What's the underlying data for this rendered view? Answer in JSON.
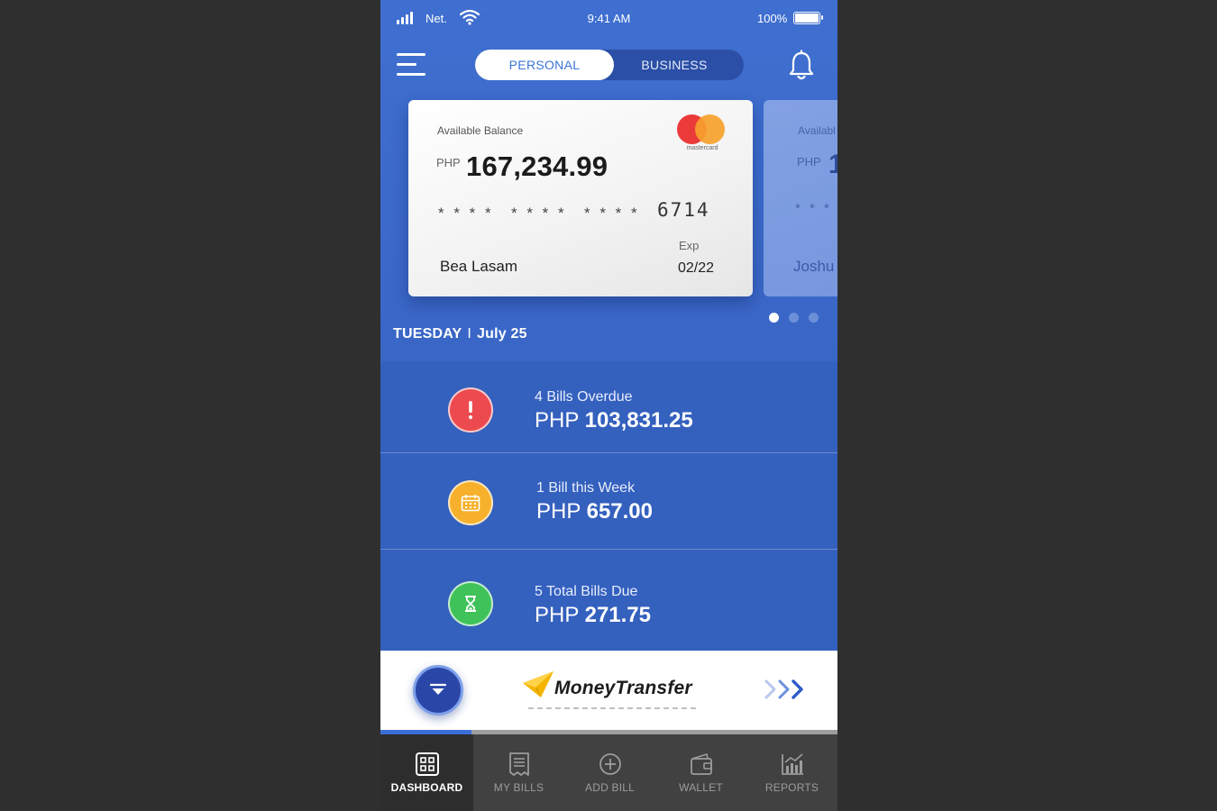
{
  "status_bar": {
    "carrier": "Net.",
    "time": "9:41 AM",
    "battery": "100%"
  },
  "header": {
    "tabs": [
      {
        "label": "PERSONAL",
        "active": true
      },
      {
        "label": "BUSINESS",
        "active": false
      }
    ],
    "menu_icon": "hamburger-menu-icon",
    "notification_icon": "bell-icon"
  },
  "cards": [
    {
      "label": "Available Balance",
      "currency": "PHP",
      "balance": "167,234.99",
      "masked_groups": [
        "* * * *",
        "* * * *",
        "* * * *"
      ],
      "last4": "6714",
      "exp_label": "Exp",
      "exp": "02/22",
      "holder": "Bea Lasam",
      "brand": "mastercard"
    },
    {
      "label": "Availabl",
      "currency": "PHP",
      "balance": "1",
      "masked": "* * * *",
      "holder": "Joshu"
    }
  ],
  "pagination": {
    "count": 3,
    "active_index": 0
  },
  "date": {
    "day": "TUESDAY",
    "separator": "I",
    "date": "July 25"
  },
  "summary": [
    {
      "label": "4 Bills Overdue",
      "currency": "PHP",
      "amount": "103,831.25",
      "icon": "exclamation-icon",
      "color": "#ec4a4f"
    },
    {
      "label": "1 Bill this Week",
      "currency": "PHP",
      "amount": "657.00",
      "icon": "calendar-icon",
      "color": "#f6b02b"
    },
    {
      "label": "5 Total Bills Due",
      "currency": "PHP",
      "amount": "271.75",
      "icon": "hourglass-icon",
      "color": "#3fc25a"
    }
  ],
  "transfer": {
    "brand": "MoneyTransfer",
    "icon": "paper-plane-icon",
    "action_icon": "triple-chevron-right-icon"
  },
  "progress": {
    "fraction": 0.2
  },
  "nav": [
    {
      "label": "DASHBOARD",
      "icon": "dashboard-icon",
      "active": true
    },
    {
      "label": "MY BILLS",
      "icon": "bills-icon",
      "active": false
    },
    {
      "label": "ADD BILL",
      "icon": "add-circle-icon",
      "active": false
    },
    {
      "label": "WALLET",
      "icon": "wallet-icon",
      "active": false
    },
    {
      "label": "REPORTS",
      "icon": "reports-icon",
      "active": false
    }
  ],
  "colors": {
    "primary": "#3a66c6",
    "summary_bg": "#3460be",
    "accent": "#3a74d6",
    "tabbar": "#414141"
  }
}
